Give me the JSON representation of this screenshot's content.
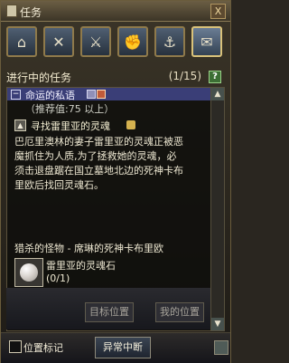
{
  "window": {
    "title": "任务",
    "close_label": "X"
  },
  "tabs": [
    {
      "label": "⌂",
      "icon": "house-icon"
    },
    {
      "label": "✕",
      "icon": "crossed-swords-icon"
    },
    {
      "label": "⚔",
      "icon": "weapon-icon"
    },
    {
      "label": "✊",
      "icon": "fist-icon"
    },
    {
      "label": "⚓",
      "icon": "boat-icon"
    },
    {
      "label": "✉",
      "icon": "scroll-icon"
    }
  ],
  "panel": {
    "header": "进行中的任务",
    "count": "(1/15)",
    "help": "?"
  },
  "quest": {
    "category": "命运的私语",
    "recommend": "（推荐值:75 以上）",
    "title": "寻找雷里亚的灵魂",
    "description": "巴厄里澳林的妻子雷里亚的灵魂正被恶\n魔抓住为人质,为了拯救她的灵魂，必\n须击退盘踞在国立墓地北边的死神卡布\n里欧后找回灵魂石。",
    "kill_objective": "猎杀的怪物 - 席琳的死神卡布里欧",
    "item_name": "雷里亚的灵魂石",
    "item_count": "(0/1)"
  },
  "lower_buttons": {
    "target_position": "目标位置",
    "my_position": "我的位置"
  },
  "bottom": {
    "position_marker_label": "位置标记",
    "abort_label": "异常中断"
  },
  "scroll": {
    "up": "▲",
    "down": "▼"
  }
}
